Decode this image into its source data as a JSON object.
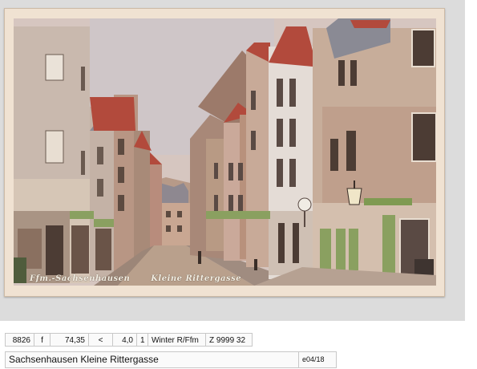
{
  "postcard": {
    "caption_left": "Ffm.-Sachsenhausen",
    "caption_right": "Kleine Rittergasse"
  },
  "stock_row": {
    "item_no": "8826",
    "flag": "f",
    "price": "74,35",
    "symbol": "<",
    "grade": "4,0",
    "qty": "1",
    "location": "Winter R/Ffm",
    "code": "Z 9999 32"
  },
  "title_row": {
    "title": "Sachsenhausen  Kleine Rittergasse",
    "ref": "e04/18"
  },
  "colors": {
    "card": "#f0e2d2",
    "sky": "#d8c8c2",
    "roof_red": "#b24a3c",
    "shutter_green": "#8aa060"
  }
}
